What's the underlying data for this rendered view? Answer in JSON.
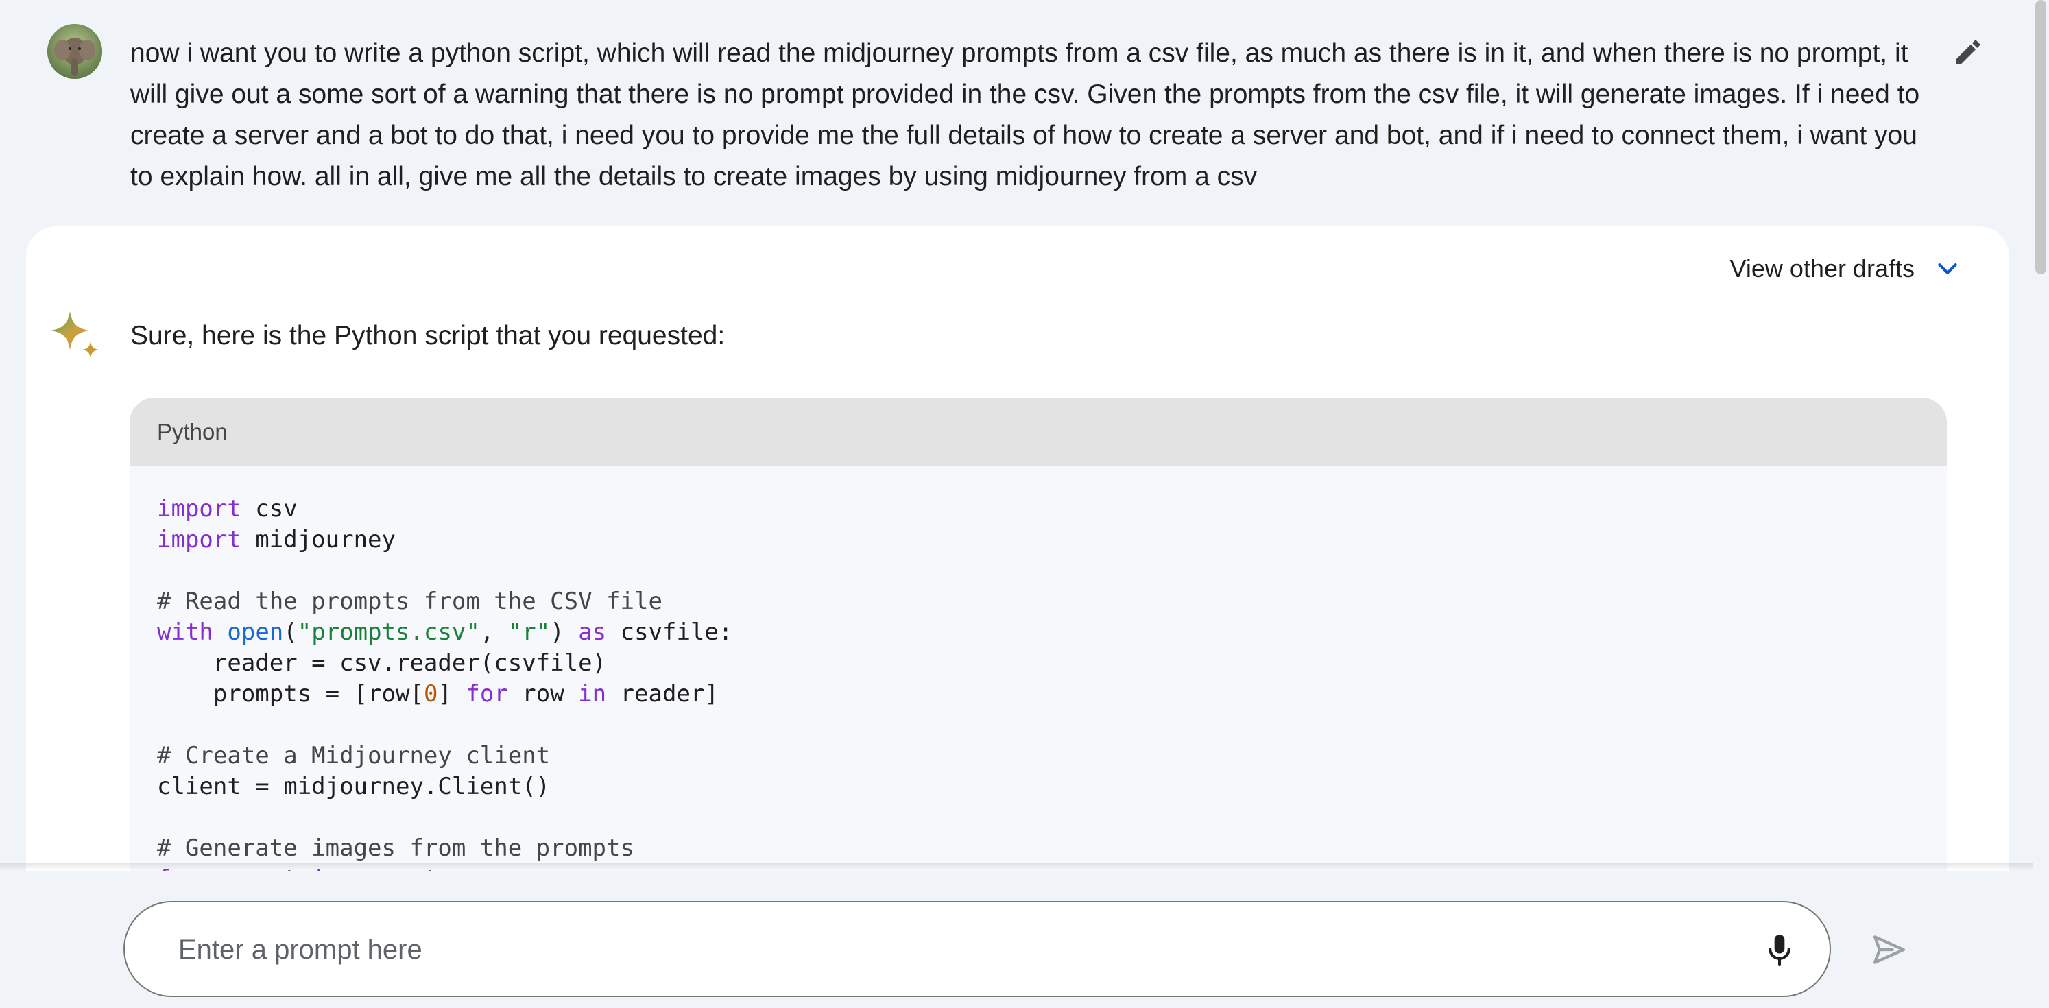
{
  "user_message": {
    "text": "now i want you to write a python script, which will read the midjourney prompts from a csv file, as much as there is in it, and when there is no prompt, it will give out a some sort of a warning that there is no prompt provided in the csv. Given the prompts from the csv file, it will generate images. If i need to create a server and a bot to do that, i need you to provide me the full details of how to create a server and bot, and if i need to connect them, i want you to explain how. all in all, give me all the details to create images by using midjourney from a csv",
    "avatar_icon": "elephant-avatar",
    "edit_icon": "pencil-icon"
  },
  "response": {
    "drafts_label": "View other drafts",
    "drafts_icon": "chevron-down-icon",
    "assistant_icon": "sparkle-icon",
    "intro": "Sure, here is the Python script that you requested:",
    "code": {
      "language": "Python",
      "lines": [
        [
          {
            "t": "import",
            "c": "kw"
          },
          {
            "t": " csv",
            "c": ""
          }
        ],
        [
          {
            "t": "import",
            "c": "kw"
          },
          {
            "t": " midjourney",
            "c": ""
          }
        ],
        [],
        [
          {
            "t": "# Read the prompts from the CSV file",
            "c": "com"
          }
        ],
        [
          {
            "t": "with",
            "c": "kw"
          },
          {
            "t": " ",
            "c": ""
          },
          {
            "t": "open",
            "c": "fn"
          },
          {
            "t": "(",
            "c": ""
          },
          {
            "t": "\"prompts.csv\"",
            "c": "str"
          },
          {
            "t": ", ",
            "c": ""
          },
          {
            "t": "\"r\"",
            "c": "str"
          },
          {
            "t": ") ",
            "c": ""
          },
          {
            "t": "as",
            "c": "kw"
          },
          {
            "t": " csvfile:",
            "c": ""
          }
        ],
        [
          {
            "t": "    reader = csv.reader(csvfile)",
            "c": ""
          }
        ],
        [
          {
            "t": "    prompts = [row[",
            "c": ""
          },
          {
            "t": "0",
            "c": "num"
          },
          {
            "t": "] ",
            "c": ""
          },
          {
            "t": "for",
            "c": "kw"
          },
          {
            "t": " row ",
            "c": ""
          },
          {
            "t": "in",
            "c": "kw"
          },
          {
            "t": " reader]",
            "c": ""
          }
        ],
        [],
        [
          {
            "t": "# Create a Midjourney client",
            "c": "com"
          }
        ],
        [
          {
            "t": "client = midjourney.Client()",
            "c": ""
          }
        ],
        [],
        [
          {
            "t": "# Generate images from the prompts",
            "c": "com"
          }
        ],
        [
          {
            "t": "for",
            "c": "kw"
          },
          {
            "t": " prompt ",
            "c": ""
          },
          {
            "t": "in",
            "c": "kw"
          },
          {
            "t": " prompts:",
            "c": ""
          }
        ]
      ]
    }
  },
  "composer": {
    "placeholder": "Enter a prompt here",
    "mic_icon": "microphone-icon",
    "send_icon": "send-icon"
  },
  "colors": {
    "background": "#f0f4f9",
    "card": "#ffffff",
    "code_bg": "#f6f8fc",
    "code_header": "#e3e3e3",
    "keyword": "#8430ce",
    "builtin": "#1967d2",
    "string": "#188038",
    "number": "#b55908",
    "accent_blue": "#1a73e8"
  }
}
